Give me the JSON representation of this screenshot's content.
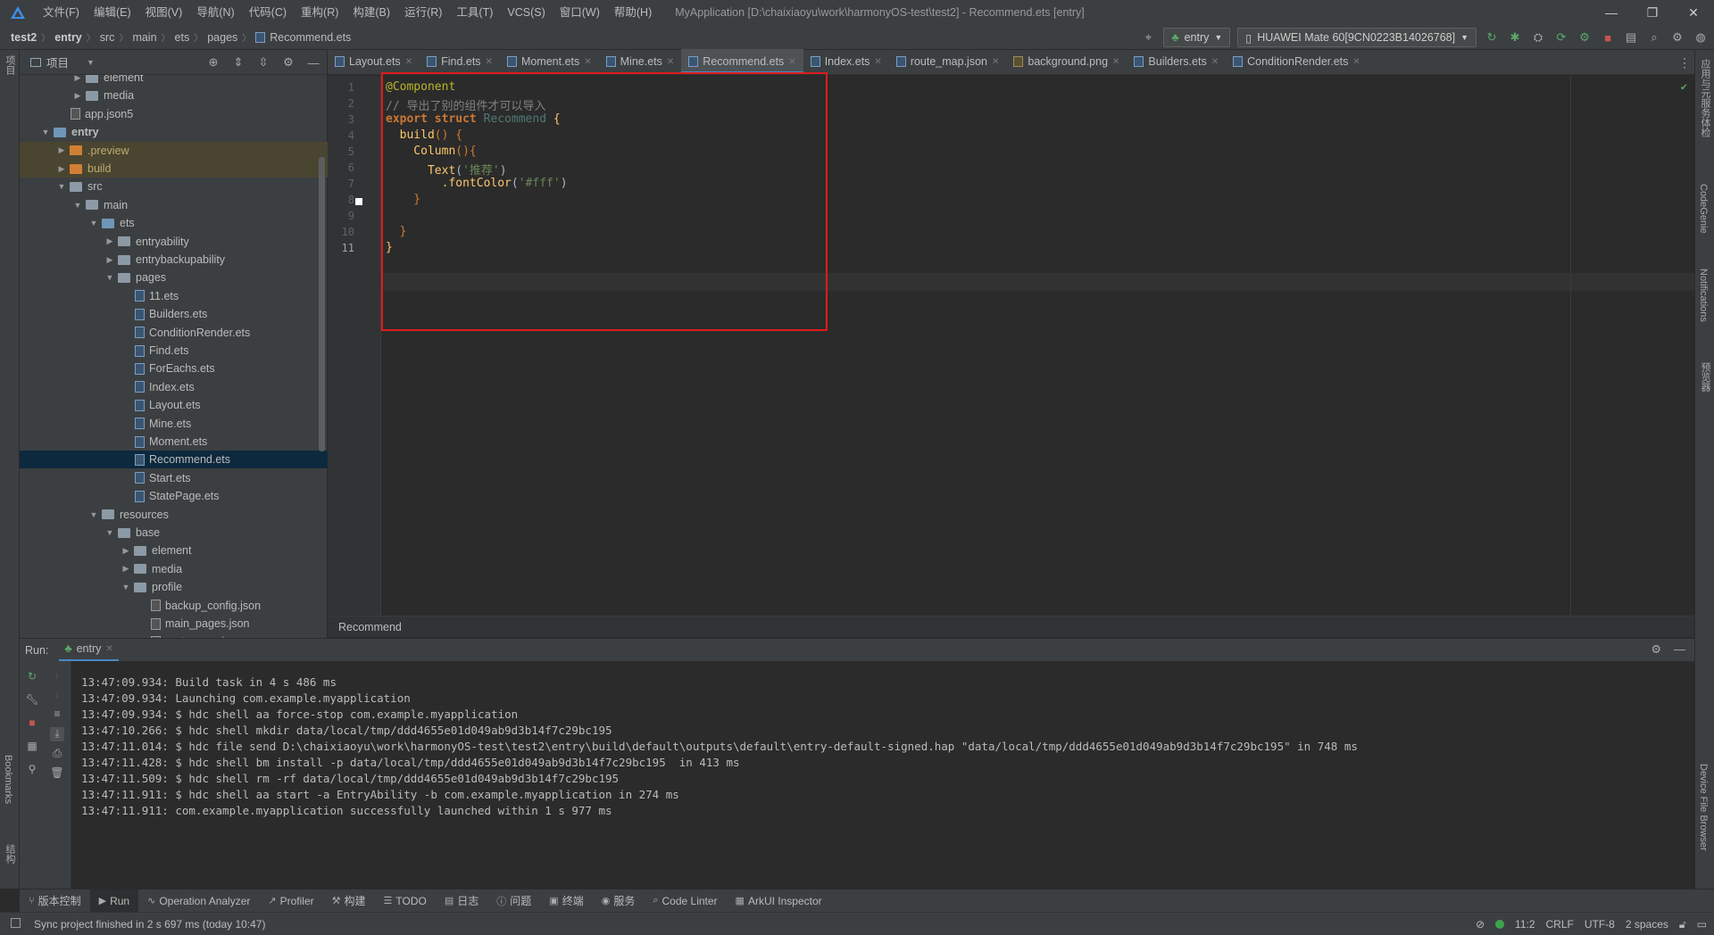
{
  "window": {
    "title": "MyApplication [D:\\chaixiaoyu\\work\\harmonyOS-test\\test2] - Recommend.ets [entry]",
    "menu": [
      "文件(F)",
      "编辑(E)",
      "视图(V)",
      "导航(N)",
      "代码(C)",
      "重构(R)",
      "构建(B)",
      "运行(R)",
      "工具(T)",
      "VCS(S)",
      "窗口(W)",
      "帮助(H)"
    ]
  },
  "breadcrumb": [
    "test2",
    "entry",
    "src",
    "main",
    "ets",
    "pages",
    "Recommend.ets"
  ],
  "nav": {
    "module": "entry",
    "device": "HUAWEI Mate 60[9CN0223B14026768]"
  },
  "project_panel": {
    "title": "项目",
    "tree": [
      {
        "label": "element",
        "depth": 3,
        "kind": "folder",
        "arrow": "›"
      },
      {
        "label": "media",
        "depth": 3,
        "kind": "folder",
        "arrow": "›"
      },
      {
        "label": "app.json5",
        "depth": 2,
        "kind": "json",
        "arrow": ""
      },
      {
        "label": "entry",
        "depth": 1,
        "kind": "folder-blue",
        "arrow": "⌄",
        "bold": true
      },
      {
        "label": ".preview",
        "depth": 2,
        "kind": "folder-orange",
        "arrow": "›",
        "hl": true
      },
      {
        "label": "build",
        "depth": 2,
        "kind": "folder-orange",
        "arrow": "›",
        "hl": true
      },
      {
        "label": "src",
        "depth": 2,
        "kind": "folder",
        "arrow": "⌄"
      },
      {
        "label": "main",
        "depth": 3,
        "kind": "folder",
        "arrow": "⌄"
      },
      {
        "label": "ets",
        "depth": 4,
        "kind": "folder-blue",
        "arrow": "⌄"
      },
      {
        "label": "entryability",
        "depth": 5,
        "kind": "folder",
        "arrow": "›"
      },
      {
        "label": "entrybackupability",
        "depth": 5,
        "kind": "folder",
        "arrow": "›"
      },
      {
        "label": "pages",
        "depth": 5,
        "kind": "folder",
        "arrow": "⌄"
      },
      {
        "label": "11.ets",
        "depth": 6,
        "kind": "file",
        "arrow": ""
      },
      {
        "label": "Builders.ets",
        "depth": 6,
        "kind": "file",
        "arrow": ""
      },
      {
        "label": "ConditionRender.ets",
        "depth": 6,
        "kind": "file",
        "arrow": ""
      },
      {
        "label": "Find.ets",
        "depth": 6,
        "kind": "file",
        "arrow": ""
      },
      {
        "label": "ForEachs.ets",
        "depth": 6,
        "kind": "file",
        "arrow": ""
      },
      {
        "label": "Index.ets",
        "depth": 6,
        "kind": "file",
        "arrow": ""
      },
      {
        "label": "Layout.ets",
        "depth": 6,
        "kind": "file",
        "arrow": ""
      },
      {
        "label": "Mine.ets",
        "depth": 6,
        "kind": "file",
        "arrow": ""
      },
      {
        "label": "Moment.ets",
        "depth": 6,
        "kind": "file",
        "arrow": ""
      },
      {
        "label": "Recommend.ets",
        "depth": 6,
        "kind": "file",
        "arrow": "",
        "sel": true
      },
      {
        "label": "Start.ets",
        "depth": 6,
        "kind": "file",
        "arrow": ""
      },
      {
        "label": "StatePage.ets",
        "depth": 6,
        "kind": "file",
        "arrow": ""
      },
      {
        "label": "resources",
        "depth": 4,
        "kind": "folder",
        "arrow": "⌄"
      },
      {
        "label": "base",
        "depth": 5,
        "kind": "folder",
        "arrow": "⌄"
      },
      {
        "label": "element",
        "depth": 6,
        "kind": "folder",
        "arrow": "›"
      },
      {
        "label": "media",
        "depth": 6,
        "kind": "folder",
        "arrow": "›"
      },
      {
        "label": "profile",
        "depth": 6,
        "kind": "folder",
        "arrow": "⌄"
      },
      {
        "label": "backup_config.json",
        "depth": 7,
        "kind": "json",
        "arrow": ""
      },
      {
        "label": "main_pages.json",
        "depth": 7,
        "kind": "json",
        "arrow": ""
      },
      {
        "label": "route_map.json",
        "depth": 7,
        "kind": "json",
        "arrow": ""
      }
    ]
  },
  "tabs": [
    {
      "label": "Layout.ets",
      "icon": "ets"
    },
    {
      "label": "Find.ets",
      "icon": "ets"
    },
    {
      "label": "Moment.ets",
      "icon": "ets"
    },
    {
      "label": "Mine.ets",
      "icon": "ets"
    },
    {
      "label": "Recommend.ets",
      "icon": "ets",
      "active": true
    },
    {
      "label": "Index.ets",
      "icon": "ets"
    },
    {
      "label": "route_map.json",
      "icon": "json"
    },
    {
      "label": "background.png",
      "icon": "png"
    },
    {
      "label": "Builders.ets",
      "icon": "ets"
    },
    {
      "label": "ConditionRender.ets",
      "icon": "ets"
    }
  ],
  "editor": {
    "current_line": 11,
    "lines": [
      [
        {
          "t": "@Component",
          "c": "ann"
        }
      ],
      [
        {
          "t": "// 导出了别的组件才可以导入",
          "c": "cmt"
        }
      ],
      [
        {
          "t": "export struct ",
          "c": "kw"
        },
        {
          "t": "Recommend ",
          "c": "cls"
        },
        {
          "t": "{",
          "c": "fn"
        }
      ],
      [
        {
          "t": "  build",
          "c": "fn"
        },
        {
          "t": "() {",
          "c": "kw2"
        }
      ],
      [
        {
          "t": "    Column",
          "c": "fn"
        },
        {
          "t": "(){",
          "c": "kw2"
        }
      ],
      [
        {
          "t": "      Text",
          "c": "fn"
        },
        {
          "t": "(",
          "c": "fn2"
        },
        {
          "t": "'推荐'",
          "c": "str"
        },
        {
          "t": ")",
          "c": "fn2"
        }
      ],
      [
        {
          "t": "        .fontColor",
          "c": "fn"
        },
        {
          "t": "(",
          "c": "fn2"
        },
        {
          "t": "'#fff'",
          "c": "str"
        },
        {
          "t": ")",
          "c": "fn2"
        }
      ],
      [
        {
          "t": "    }",
          "c": "kw2"
        }
      ],
      [
        {
          "t": "",
          "c": "fn2"
        }
      ],
      [
        {
          "t": "  }",
          "c": "kw2"
        }
      ],
      [
        {
          "t": "}",
          "c": "fn"
        }
      ]
    ],
    "breadcrumb_footer": "Recommend"
  },
  "run_panel": {
    "label": "Run:",
    "tab": "entry",
    "logs": [
      "13:47:09.934: Build task in 4 s 486 ms",
      "13:47:09.934: Launching com.example.myapplication",
      "13:47:09.934: $ hdc shell aa force-stop com.example.myapplication",
      "13:47:10.266: $ hdc shell mkdir data/local/tmp/ddd4655e01d049ab9d3b14f7c29bc195",
      "13:47:11.014: $ hdc file send D:\\chaixiaoyu\\work\\harmonyOS-test\\test2\\entry\\build\\default\\outputs\\default\\entry-default-signed.hap \"data/local/tmp/ddd4655e01d049ab9d3b14f7c29bc195\" in 748 ms",
      "13:47:11.428: $ hdc shell bm install -p data/local/tmp/ddd4655e01d049ab9d3b14f7c29bc195  in 413 ms",
      "13:47:11.509: $ hdc shell rm -rf data/local/tmp/ddd4655e01d049ab9d3b14f7c29bc195",
      "13:47:11.911: $ hdc shell aa start -a EntryAbility -b com.example.myapplication in 274 ms",
      "13:47:11.911: com.example.myapplication successfully launched within 1 s 977 ms"
    ]
  },
  "bottom_tabs": [
    {
      "label": "版本控制",
      "icon": "⑂"
    },
    {
      "label": "Run",
      "icon": "▶",
      "active": true
    },
    {
      "label": "Operation Analyzer",
      "icon": "∿"
    },
    {
      "label": "Profiler",
      "icon": "↗"
    },
    {
      "label": "构建",
      "icon": "⚒"
    },
    {
      "label": "TODO",
      "icon": "☰"
    },
    {
      "label": "日志",
      "icon": "▤"
    },
    {
      "label": "问题",
      "icon": "ⓘ"
    },
    {
      "label": "终端",
      "icon": "▣"
    },
    {
      "label": "服务",
      "icon": "◉"
    },
    {
      "label": "Code Linter",
      "icon": "⌕"
    },
    {
      "label": "ArkUI Inspector",
      "icon": "▦"
    }
  ],
  "status": {
    "message": "Sync project finished in 2 s 697 ms (today 10:47)",
    "position": "11:2",
    "line_ending": "CRLF",
    "encoding": "UTF-8",
    "indent": "2 spaces"
  },
  "side_labels": {
    "left_top": "项目",
    "left_bookmarks": "Bookmarks",
    "left_structure": "结构",
    "right_1": "应用与元服务体检",
    "right_2": "CodeGenie",
    "right_3": "Notifications",
    "right_4": "预览器",
    "right_5": "Device File Browser"
  }
}
